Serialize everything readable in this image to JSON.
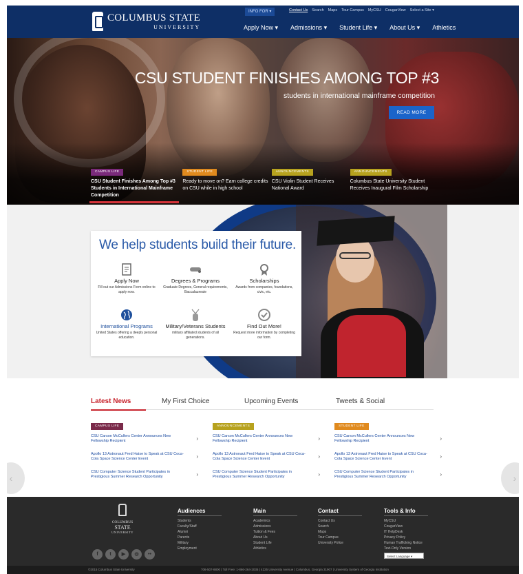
{
  "header": {
    "logo_line1": "COLUMBUS STATE",
    "logo_line2": "UNIVERSITY",
    "info_for": "INFO FOR ▾",
    "utility": [
      "Contact Us",
      "Search",
      "Maps",
      "Tour Campus",
      "MyCSU",
      "CougarView",
      "Select a Site ▾"
    ],
    "nav": [
      "Apply Now ▾",
      "Admissions ▾",
      "Student Life ▾",
      "About Us ▾",
      "Athletics"
    ]
  },
  "hero": {
    "title": "CSU STUDENT FINISHES AMONG TOP #3",
    "subtitle": "students in international mainframe competition",
    "read_more": "READ MORE",
    "stories": [
      {
        "badge": "CAMPUS LIFE",
        "badge_color": "#7a2a7a",
        "title": "CSU Student Finishes Among Top #3 Students in International Mainframe Competition"
      },
      {
        "badge": "STUDENT LIFE",
        "badge_color": "#e08a1e",
        "title": "Ready to move on? Earn college credits on CSU while in high school"
      },
      {
        "badge": "ANNOUNCEMENTS",
        "badge_color": "#b7a21e",
        "title": "CSU Violin Student Receives National Award"
      },
      {
        "badge": "ANNOUNCEMENTS",
        "badge_color": "#b7a21e",
        "title": "Columbus State University Student Receives Inaugural Film Scholarship"
      }
    ]
  },
  "help": {
    "title": "We help students build their future.",
    "items": [
      {
        "icon": "document-icon",
        "title": "Apply Now",
        "desc": "Fill out our Admissions Form online to apply now."
      },
      {
        "icon": "diploma-icon",
        "title": "Degrees & Programs",
        "desc": "Graduate Degrees, General requirements, Baccalaureate"
      },
      {
        "icon": "award-ribbon-icon",
        "title": "Scholarships",
        "desc": "Awards from companies, foundations, civic, etc."
      },
      {
        "icon": "globe-icon",
        "title": "International Programs",
        "desc": "United States offering a deeply personal education."
      },
      {
        "icon": "dog-tag-icon",
        "title": "Military/Veterans Students",
        "desc": "military affiliated students of all generations."
      },
      {
        "icon": "check-circle-icon",
        "title": "Find Out More!",
        "desc": "Request more information by completing our form."
      }
    ]
  },
  "news": {
    "tabs": [
      "Latest News",
      "My First Choice",
      "Upcoming Events",
      "Tweets & Social"
    ],
    "columns": [
      {
        "badge": "CAMPUS LIFE",
        "badge_color": "#7a2a4a",
        "items": [
          "CSU Carson McCullers Center Announces New Fellowship Recipient",
          "Apollo 13 Astronaut Fred Haise to Speak at CSU Coca-Cola Space Science Center Event",
          "CSU Computer Science Student Participates in Prestigious Summer Research Opportunity"
        ]
      },
      {
        "badge": "ANNOUNCEMENTS",
        "badge_color": "#b7a21e",
        "items": [
          "CSU Carson McCullers Center Announces New Fellowship Recipient",
          "Apollo 13 Astronaut Fred Haise to Speak at CSU Coca-Cola Space Science Center Event",
          "CSU Computer Science Student Participates in Prestigious Summer Research Opportunity"
        ]
      },
      {
        "badge": "STUDENT LIFE",
        "badge_color": "#e08a1e",
        "items": [
          "CSU Carson McCullers Center Announces New Fellowship Recipient",
          "Apollo 13 Astronaut Fred Haise to Speak at CSU Coca-Cola Space Science Center Event",
          "CSU Computer Science Student Participates in Prestigious Summer Research Opportunity"
        ]
      }
    ],
    "prev_arrow": "‹",
    "next_arrow": "›"
  },
  "footer": {
    "logo_line1": "COLUMBUS",
    "logo_line2": "STATE",
    "logo_line3": "UNIVERSITY",
    "social": [
      "f",
      "t",
      "▶",
      "◎",
      "••"
    ],
    "columns": [
      {
        "heading": "Audiences",
        "links": [
          "Students",
          "Faculty/Staff",
          "Alumni",
          "Parents",
          "Military",
          "Employment"
        ]
      },
      {
        "heading": "Main",
        "links": [
          "Academics",
          "Admissions",
          "Tuition & Fees",
          "About Us",
          "Student Life",
          "Athletics"
        ]
      },
      {
        "heading": "Contact",
        "links": [
          "Contact Us",
          "Search",
          "Maps",
          "Tour Campus",
          "University Police"
        ]
      },
      {
        "heading": "Tools & Info",
        "links": [
          "MyCSU",
          "CougarView",
          "IT HelpDesk",
          "Privacy Policy",
          "Human Trafficking Notice",
          "Text-Only Version"
        ]
      }
    ],
    "language": "Select Language ▾",
    "copyright": "©2015 Columbus State University",
    "address": "706-507-8800  |  Toll Free: 1-866-264-2035  |  4225 University Avenue  |  Columbus, Georgia 31907  |  University System of Georgia Institution"
  },
  "colors": {
    "header_blue": "#0e2f66",
    "accent_red": "#c8232c",
    "link_blue": "#1a4aa0",
    "read_more": "#1b64c9"
  }
}
